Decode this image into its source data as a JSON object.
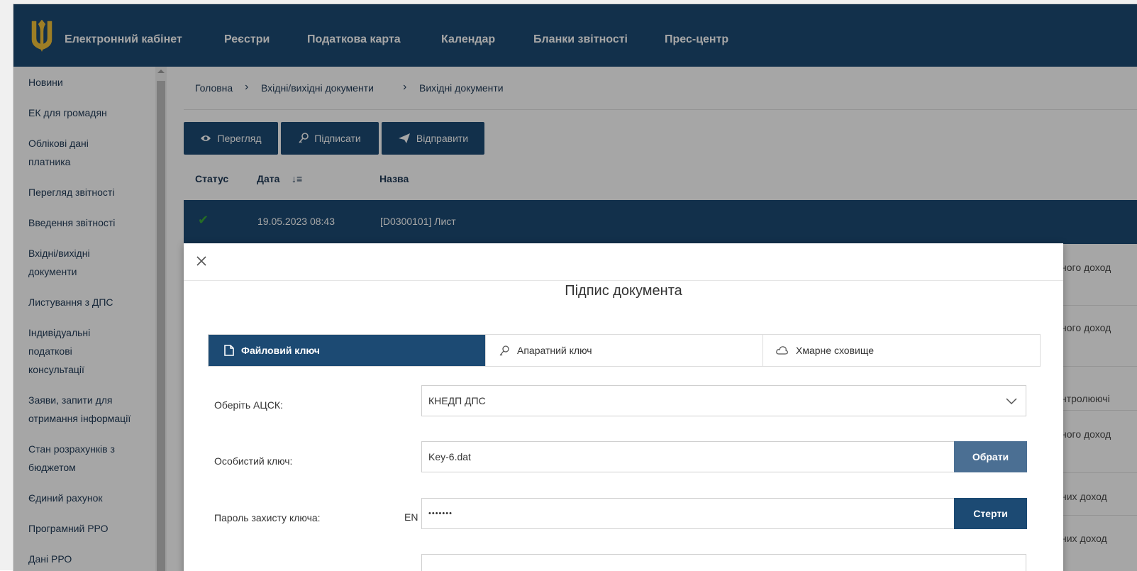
{
  "header": {
    "brand": "Електронний кабінет",
    "nav": [
      "Реєстри",
      "Податкова карта",
      "Календар",
      "Бланки звітності",
      "Прес-центр"
    ]
  },
  "sidebar": {
    "items": [
      {
        "label": "Новини"
      },
      {
        "label": "ЕК для громадян"
      },
      {
        "label": "Облікові дані платника"
      },
      {
        "label": "Перегляд звітності"
      },
      {
        "label": "Введення звітності"
      },
      {
        "label": "Вхідні/вихідні документи"
      },
      {
        "label": "Листування з ДПС"
      },
      {
        "label": "Індивідуальні податкові консультації"
      },
      {
        "label": "Заяви, запити для отримання інформації"
      },
      {
        "label": "Стан розрахунків з бюджетом"
      },
      {
        "label": "Єдиний рахунок"
      },
      {
        "label": "Програмний РРО"
      },
      {
        "label": "Дані РРО"
      }
    ]
  },
  "breadcrumb": [
    "Головна",
    "Вхідні/вихідні документи",
    "Вихідні документи"
  ],
  "toolbar": {
    "view": "Перегляд",
    "sign": "Підписати",
    "send": "Відправити"
  },
  "table": {
    "headers": {
      "status": "Статус",
      "date": "Дата",
      "name": "Назва"
    },
    "selected_row": {
      "date": "19.05.2023 08:43",
      "name": "[D0300101] Лист"
    },
    "peek": [
      "ного доход",
      "ного доход",
      "нтролюючі",
      "ного доход",
      "них доход",
      "них доход"
    ]
  },
  "modal": {
    "title": "Підпис документа",
    "tabs": [
      "Файловий ключ",
      "Апаратний ключ",
      "Хмарне сховище"
    ],
    "fields": {
      "acsk_label": "Оберіть АЦСК:",
      "acsk_value": "КНЕДП ДПС",
      "key_label": "Особистий ключ:",
      "key_value": "Key-6.dat",
      "key_button": "Обрати",
      "password_label": "Пароль захисту ключа:",
      "password_lang": "EN",
      "password_value": "•••••••",
      "password_button": "Стерти"
    }
  },
  "colors": {
    "primary": "#1c4a73",
    "status_ok": "#3aa83a"
  }
}
